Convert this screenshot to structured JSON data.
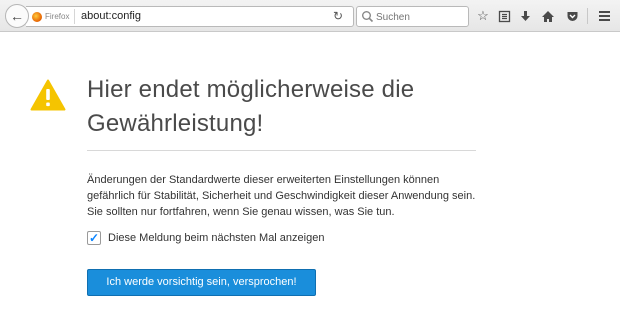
{
  "browser": {
    "identity_label": "Firefox",
    "url": "about:config",
    "search": {
      "placeholder": "Suchen"
    },
    "icons": [
      "back-icon",
      "firefox-logo-icon",
      "reload-icon",
      "search-icon",
      "star-icon",
      "reading-list-icon",
      "download-icon",
      "home-icon",
      "pocket-icon",
      "menu-icon"
    ]
  },
  "warning": {
    "title": "Hier endet möglicherweise die Gewährleistung!",
    "description": "Änderungen der Standardwerte dieser erweiterten Einstellungen können gefährlich für Stabilität, Sicherheit und Geschwindigkeit dieser Anwendung sein. Sie sollten nur fortfahren, wenn Sie genau wissen, was Sie tun.",
    "checkbox_label": "Diese Meldung beim nächsten Mal anzeigen",
    "checkbox_checked": true,
    "accept_button": "Ich werde vorsichtig sein, versprochen!",
    "icon": "warning-icon",
    "colors": {
      "warning": "#f5c400",
      "accent": "#1a8edb"
    }
  }
}
